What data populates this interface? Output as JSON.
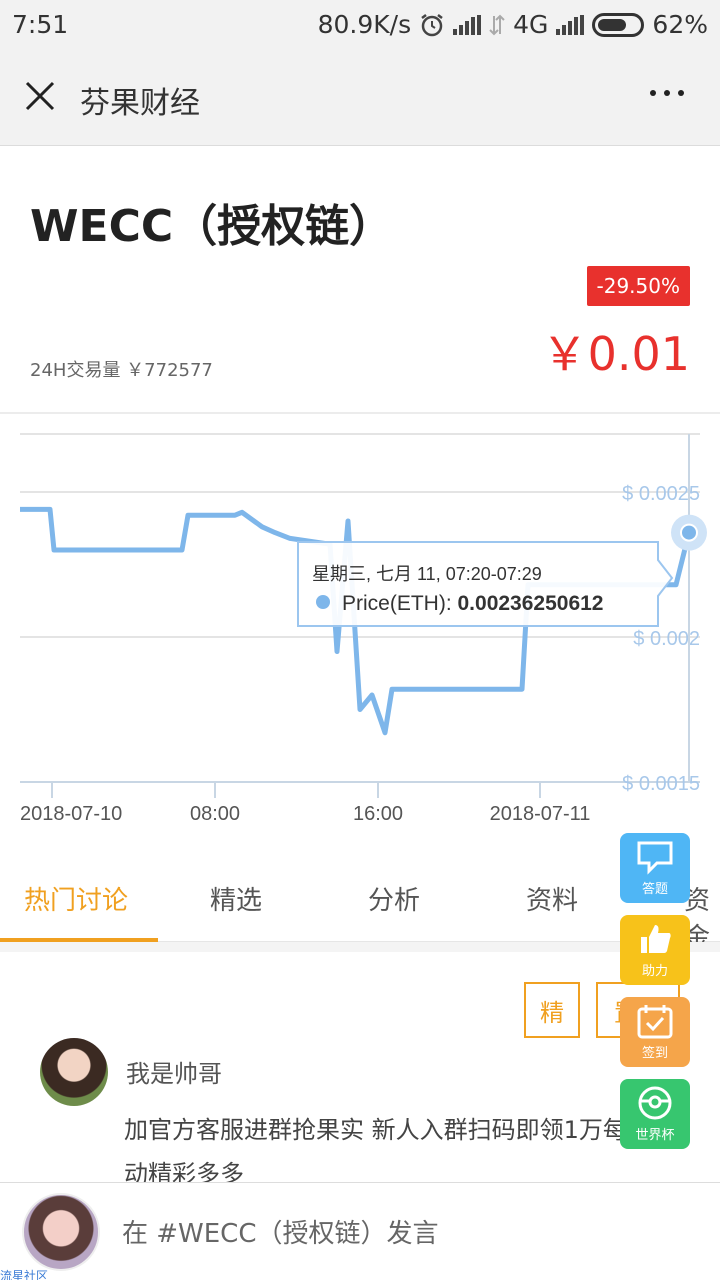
{
  "status_bar": {
    "time": "7:51",
    "net_speed": "80.9K/s",
    "network": "4G",
    "battery": "62%"
  },
  "title_bar": {
    "title": "芬果财经"
  },
  "coin": {
    "name": "WECC（授权链）",
    "change": "-29.50%",
    "price": "￥0.01",
    "volume": "24H交易量 ￥772577"
  },
  "chart_data": {
    "type": "line",
    "series": [
      {
        "name": "Price(ETH)",
        "color": "#7eb6ea",
        "values": [
          0.00244,
          0.00244,
          0.0023,
          0.0023,
          0.00242,
          0.00242,
          0.00243,
          0.00239,
          0.00238,
          0.00236,
          0.00234,
          0.00232,
          0.00195,
          0.0024,
          0.00175,
          0.0018,
          0.00167,
          0.00182,
          0.00182,
          0.00182,
          0.00218,
          0.00218,
          0.00218,
          0.00236
        ]
      }
    ],
    "x_ticks": [
      "2018-07-10",
      "08:00",
      "16:00",
      "2018-07-11"
    ],
    "y_ticks": [
      "$ 0.0025",
      "$ 0.002",
      "$ 0.0015"
    ],
    "ylim": [
      0.0015,
      0.0027
    ],
    "tooltip": {
      "title": "星期三, 七月 11, 07:20-07:29",
      "series_label": "Price(ETH): ",
      "value": "0.00236250612"
    }
  },
  "tabs": [
    "热门讨论",
    "精选",
    "分析",
    "资料",
    "资金"
  ],
  "post": {
    "tag_featured": "精",
    "tag_pinned": "置顶",
    "author": "我是帅哥",
    "text": "加官方客服进群抢果实 新人入群扫码即领1万每日活动精彩多多"
  },
  "floating_buttons": [
    {
      "label": "答题",
      "icon": "chat-bubble-icon",
      "color": "#4fb6f5"
    },
    {
      "label": "助力",
      "icon": "thumbs-up-icon",
      "color": "#f7c21a"
    },
    {
      "label": "签到",
      "icon": "checkin-icon",
      "color": "#f5a54a"
    },
    {
      "label": "世界杯",
      "icon": "football-icon",
      "color": "#37c66f"
    }
  ],
  "bottom_bar": {
    "compose_placeholder": "在 #WECC（授权链）发言",
    "watermark": "流星社区"
  }
}
